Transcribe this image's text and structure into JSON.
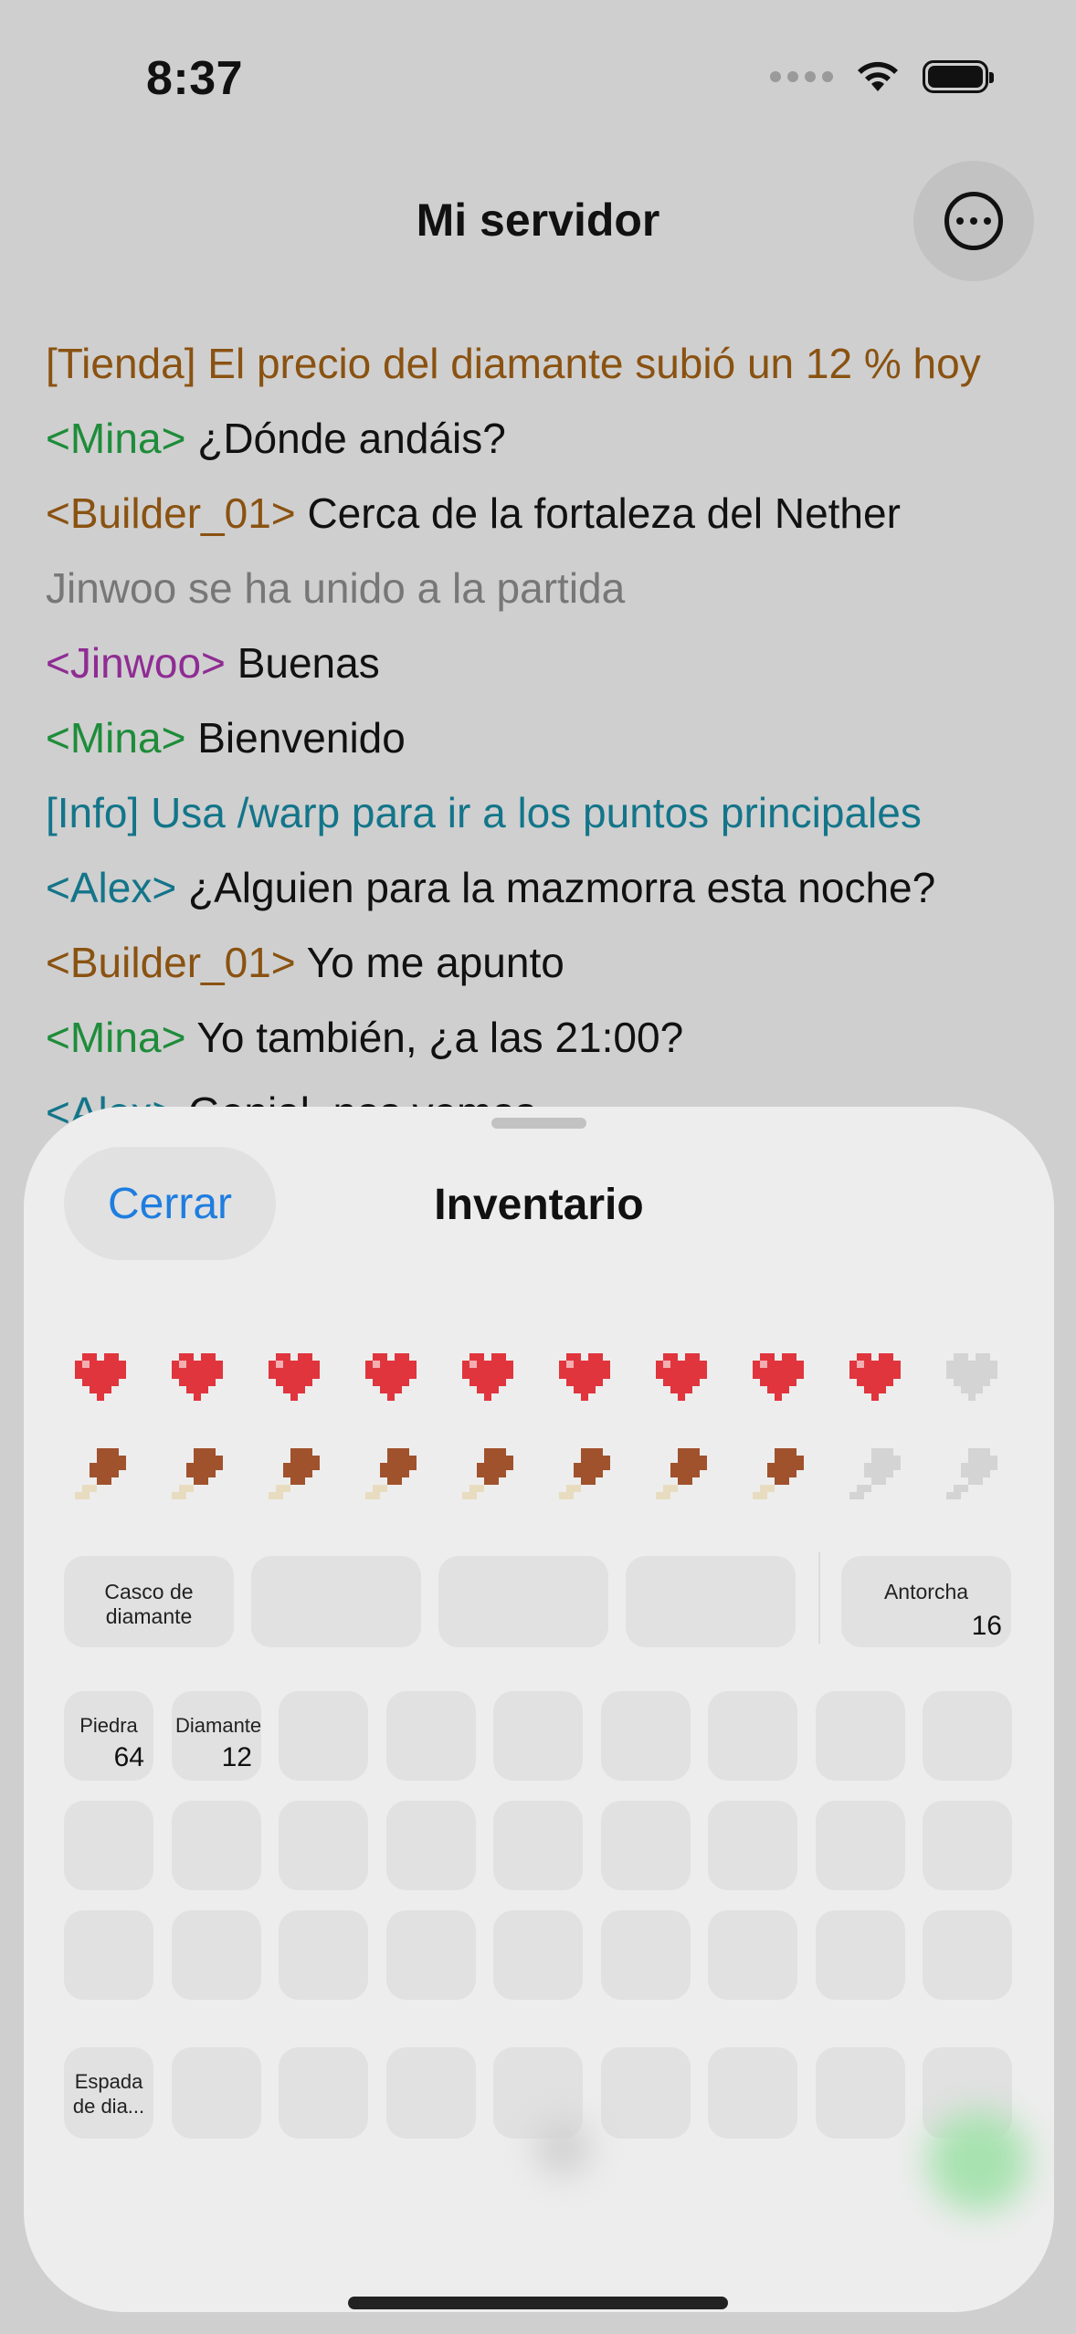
{
  "status": {
    "time": "8:37"
  },
  "nav": {
    "title": "Mi servidor",
    "more_icon": "ellipsis-circle-icon"
  },
  "chat": [
    {
      "tag": "[Tienda] ",
      "text": "El precio del diamante subió un 12 % hoy",
      "kind": "tienda"
    },
    {
      "tag": "<Mina>",
      "text": " ¿Dónde andáis?",
      "kind": "mina"
    },
    {
      "tag": "<Builder_01>",
      "text": " Cerca de la fortaleza del Nether",
      "kind": "builder"
    },
    {
      "tag": "",
      "text": "Jinwoo se ha unido a la partida",
      "kind": "join"
    },
    {
      "tag": "<Jinwoo>",
      "text": " Buenas",
      "kind": "jinwoo"
    },
    {
      "tag": "<Mina>",
      "text": " Bienvenido",
      "kind": "mina"
    },
    {
      "tag": "[Info] ",
      "text": "Usa /warp para ir a los puntos principales",
      "kind": "info"
    },
    {
      "tag": "<Alex>",
      "text": " ¿Alguien para la mazmorra esta noche?",
      "kind": "alex"
    },
    {
      "tag": "<Builder_01>",
      "text": " Yo me apunto",
      "kind": "builder"
    },
    {
      "tag": "<Mina>",
      "text": " Yo también, ¿a las 21:00?",
      "kind": "mina"
    },
    {
      "tag": "<Alex>",
      "text": " Genial, nos vemos",
      "kind": "alex"
    }
  ],
  "sheet": {
    "close_label": "Cerrar",
    "title": "Inventario",
    "health": {
      "full": 9,
      "max": 10
    },
    "hunger": {
      "full": 8,
      "max": 10
    },
    "armor_slots": [
      {
        "name": "Casco de diamante",
        "count": ""
      },
      {
        "name": "",
        "count": ""
      },
      {
        "name": "",
        "count": ""
      },
      {
        "name": "",
        "count": ""
      }
    ],
    "offhand": {
      "name": "Antorcha",
      "count": "16"
    },
    "inventory": [
      {
        "name": "Piedra",
        "count": "64"
      },
      {
        "name": "Diamante",
        "count": "12"
      }
    ],
    "hotbar": [
      {
        "name": "Espada de dia...",
        "count": ""
      }
    ]
  },
  "colors": {
    "tienda": "#8a5211",
    "mina": "#1e8c3a",
    "builder": "#8a5211",
    "join": "#777777",
    "jinwoo": "#8f2c94",
    "info": "#13758a",
    "alex": "#13758a",
    "heart": "#e0353d",
    "heart_empty": "#d4d4d4",
    "meat": "#a0522d",
    "bone": "#e8dcc0",
    "link": "#1f7de0"
  }
}
